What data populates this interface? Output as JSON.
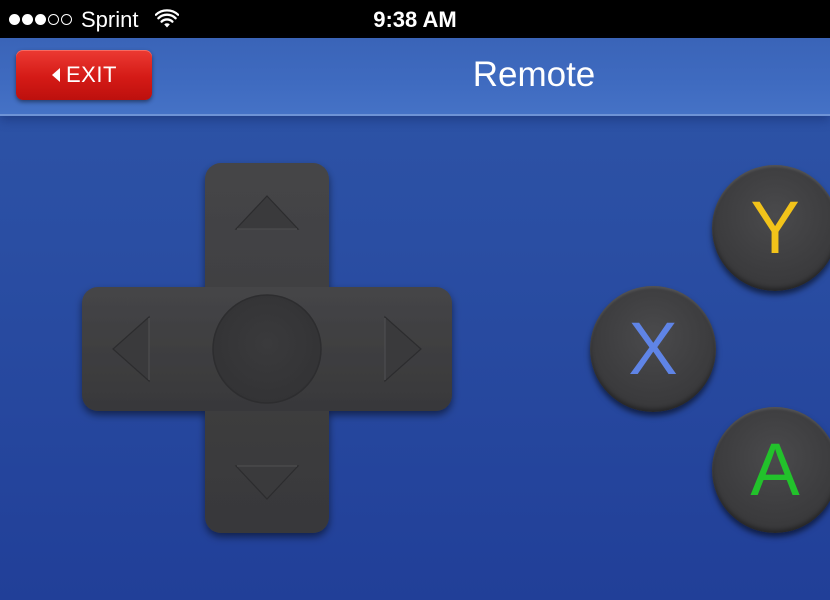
{
  "status_bar": {
    "signal_strength": {
      "filled": 3,
      "total": 5
    },
    "carrier": "Sprint",
    "wifi_icon": "wifi-icon",
    "time": "9:38 AM"
  },
  "nav_bar": {
    "exit_button": {
      "label": "EXIT",
      "icon": "chevron-left-icon"
    },
    "title": "Remote"
  },
  "controller": {
    "dpad": {
      "up_icon": "triangle-up-icon",
      "down_icon": "triangle-down-icon",
      "left_icon": "triangle-left-icon",
      "right_icon": "triangle-right-icon"
    },
    "buttons": [
      {
        "label": "Y",
        "color": "#f2c31a"
      },
      {
        "label": "X",
        "color": "#5f84e6"
      },
      {
        "label": "A",
        "color": "#22c22b"
      }
    ]
  },
  "colors": {
    "background": "#2a4ea3",
    "nav_bar": "#3f6bc0",
    "exit_button": "#d41a16",
    "controller_body": "#3d3d3f"
  }
}
